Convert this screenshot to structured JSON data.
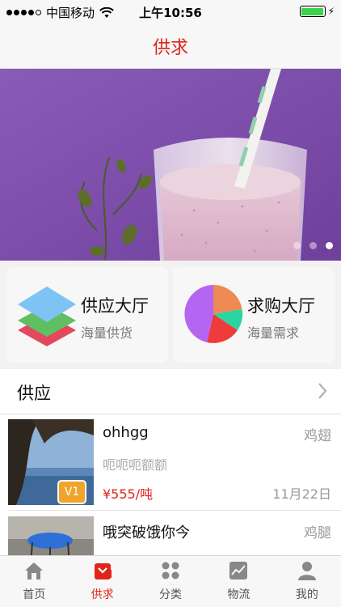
{
  "status_bar": {
    "carrier": "中国移动",
    "time": "上午10:56",
    "signal_dots": 4
  },
  "nav": {
    "title": "供求"
  },
  "banner": {
    "page_count": 3,
    "active_page": 3
  },
  "categories": [
    {
      "title": "供应大厅",
      "subtitle": "海量供货",
      "icon": "layers-icon"
    },
    {
      "title": "求购大厅",
      "subtitle": "海量需求",
      "icon": "pie-chart-icon"
    }
  ],
  "section": {
    "title": "供应"
  },
  "list": [
    {
      "name": "ohhgg",
      "tag": "鸡翅",
      "desc": "呃呃呃额额",
      "price": "¥555/吨",
      "date": "11月22日",
      "badge": "V1"
    },
    {
      "name": "哦突破饿你今",
      "tag": "鸡腿"
    }
  ],
  "tabs": [
    {
      "label": "首页",
      "icon": "home-icon",
      "active": false
    },
    {
      "label": "供求",
      "icon": "supply-icon",
      "active": true
    },
    {
      "label": "分类",
      "icon": "category-icon",
      "active": false
    },
    {
      "label": "物流",
      "icon": "logistics-icon",
      "active": false
    },
    {
      "label": "我的",
      "icon": "profile-icon",
      "active": false
    }
  ],
  "colors": {
    "accent": "#e0241b",
    "badge": "#f0a42a",
    "battery": "#3ad34a"
  }
}
